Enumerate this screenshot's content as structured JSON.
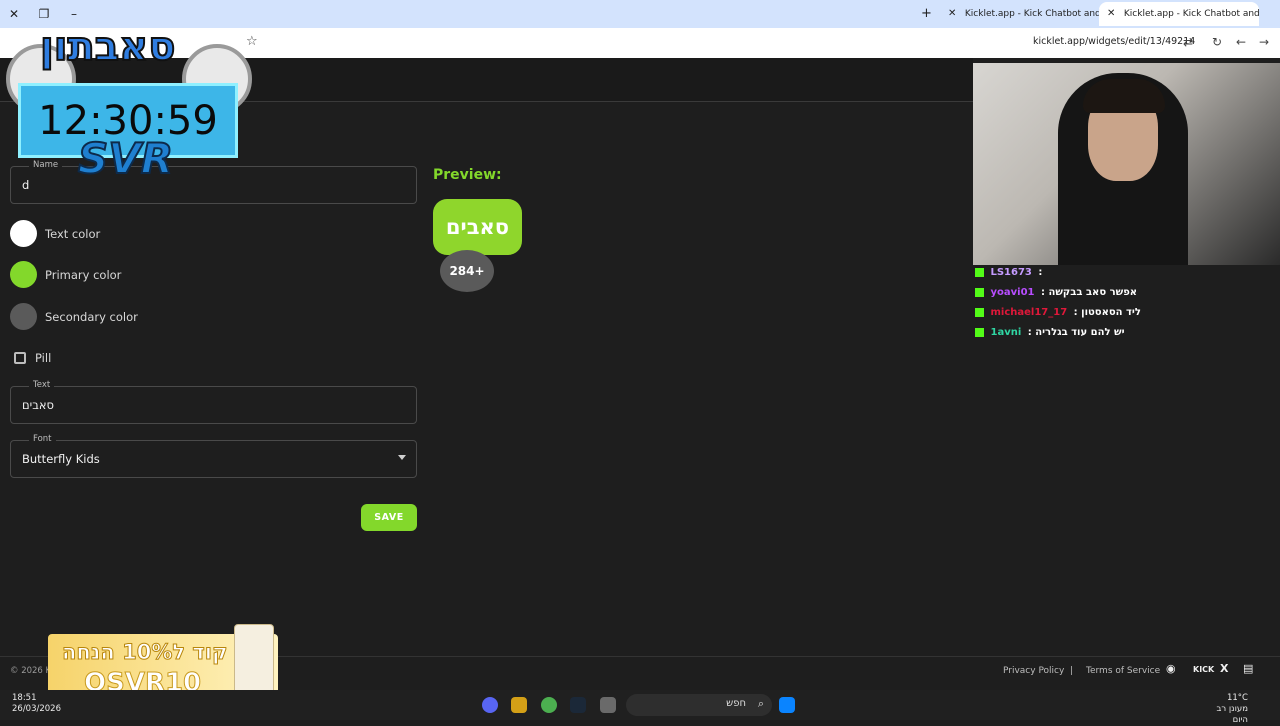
{
  "browser": {
    "tabs": [
      {
        "label": "Kicklet.app - Kick Chatbot and"
      },
      {
        "label": "Kicklet.app - Kick Chatbot and"
      }
    ],
    "url": "kicklet.app/widgets/edit/13/49214"
  },
  "form": {
    "name_label": "Name",
    "name_value": "d",
    "text_color_label": "Text color",
    "primary_color_label": "Primary color",
    "secondary_color_label": "Secondary color",
    "pill_label": "Pill",
    "text_label": "Text",
    "text_value": "סאבים",
    "font_label": "Font",
    "font_value": "Butterfly Kids",
    "save_label": "SAVE",
    "colors": {
      "text": "#ffffff",
      "primary": "#83d82b",
      "secondary": "#5a5a5a"
    }
  },
  "preview": {
    "label": "Preview:",
    "pill_text": "סאבים",
    "count_text": "284+"
  },
  "footer": {
    "copyright": "© 2026 Ki",
    "privacy": "Privacy Policy",
    "separator": "|",
    "terms": "Terms of Service",
    "kick": "KICK",
    "x": "X"
  },
  "overlay": {
    "logo_text": "סאבתון",
    "time": "12:30:59",
    "brand": "SVR",
    "promo_line": "קוד ל10% הנחה",
    "promo_code": "OSVR10"
  },
  "chat": [
    {
      "user": "LS1673",
      "sep": ":",
      "msg": "",
      "color": "#c59bff"
    },
    {
      "user": "yoavi01",
      "sep": ":",
      "msg": "אפשר סאב בבקשה",
      "color": "#b84dff"
    },
    {
      "user": "michael17_17",
      "sep": ":",
      "msg": "ליד הסאסטון",
      "color": "#e0183a"
    },
    {
      "user": "1avni",
      "sep": ":",
      "msg": "יש להם עוד בגלריה",
      "color": "#2fd6a3"
    }
  ],
  "taskbar": {
    "time": "18:51",
    "date": "26/03/2026",
    "search_placeholder": "חפש",
    "temp": "11°C",
    "weather_text": "מעונן רב היום"
  }
}
